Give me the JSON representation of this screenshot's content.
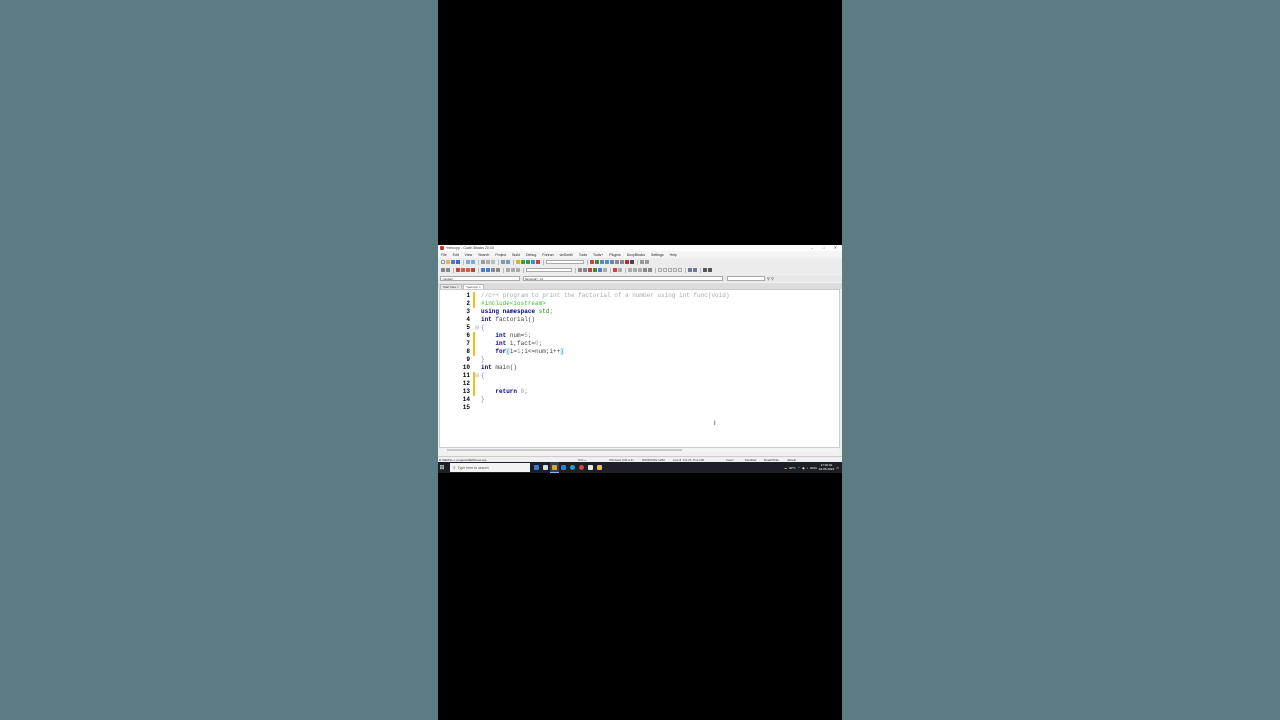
{
  "window": {
    "title": "*new.cpp - Code::Blocks 20.03",
    "controls": [
      "–",
      "□",
      "✕"
    ]
  },
  "menu": [
    "File",
    "Edit",
    "View",
    "Search",
    "Project",
    "Build",
    "Debug",
    "Fortran",
    "wxSmith",
    "Tools",
    "Tools+",
    "Plugins",
    "DoxyBlocks",
    "Settings",
    "Help"
  ],
  "scope": {
    "left": "<global>",
    "right": "factorial() : int"
  },
  "tabs": [
    {
      "label": "Start here",
      "active": false
    },
    {
      "label": "*new.cpp",
      "active": true
    }
  ],
  "editor": {
    "line_numbers": [
      "1",
      "2",
      "3",
      "4",
      "5",
      "6",
      "7",
      "8",
      "9",
      "10",
      "11",
      "12",
      "13",
      "14",
      "15"
    ],
    "lines": {
      "l1": "//c++ program to print the factorial of a number using int func(void)",
      "l2_a": "#include",
      "l2_b": "<iostream>",
      "l3_a": "using",
      "l3_b": "namespace",
      "l3_c": "std",
      "l3_d": ";",
      "l4_a": "int",
      "l4_b": "factorial()",
      "l5": "{",
      "l6_a": "int",
      "l6_b": "num=",
      "l6_c": "5",
      "l6_d": ";",
      "l7_a": "int",
      "l7_b": "i,fact=",
      "l7_c": "0",
      "l7_d": ";",
      "l8_a": "for",
      "l8_b": "(",
      "l8_c": "i=",
      "l8_d": "1",
      "l8_e": ";i<=num;i++",
      "l8_f": ")",
      "l9": "}",
      "l10_a": "int",
      "l10_b": "main()",
      "l11": "{",
      "l13_a": "return",
      "l13_b": "0",
      "l13_c": ";",
      "l14": "}"
    }
  },
  "status": {
    "path": "D:\\NEW\\c++ projects\\NEW\\new.cpp",
    "language": "C/C++",
    "eol": "Windows (CR+LF)",
    "encoding": "WINDOWS-1252",
    "position": "Line 8, Col 21, Pos 190",
    "mode": "Insert",
    "modified": "Modified",
    "access": "Read/Write",
    "profile": "default"
  },
  "taskbar": {
    "search_placeholder": "Type here to search",
    "weather": "30°C",
    "lang": "ENG",
    "time": "17:00:02",
    "date": "04-05-2023"
  },
  "colors": {
    "desktop_bg": "#5a7c82",
    "keyword": "#00007f",
    "comment": "#aaaaaa",
    "preprocessor": "#3db83d",
    "taskbar": "#1c1f26"
  }
}
